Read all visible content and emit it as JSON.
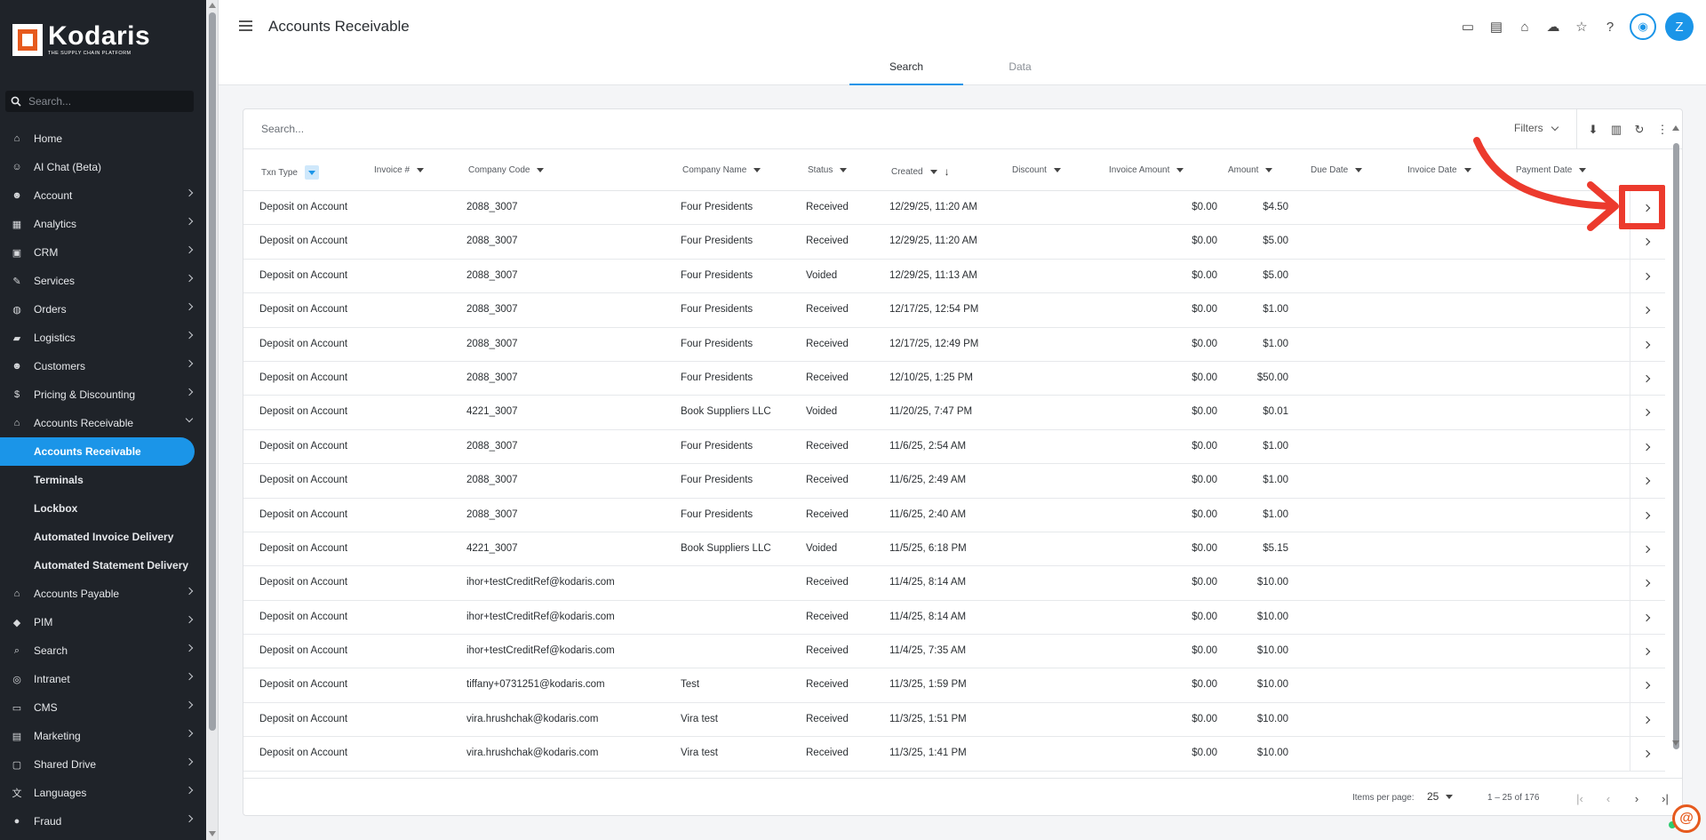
{
  "brand": {
    "name": "Kodaris",
    "tagline": "THE SUPPLY CHAIN PLATFORM",
    "accent": "#1b95e8",
    "logo_color": "#e65a1e"
  },
  "sidebar": {
    "search_placeholder": "Search...",
    "items": [
      {
        "label": "Home",
        "icon": "home-icon",
        "type": "top"
      },
      {
        "label": "AI Chat (Beta)",
        "icon": "robot-icon",
        "type": "top"
      },
      {
        "label": "Account",
        "icon": "person-icon",
        "type": "expand"
      },
      {
        "label": "Analytics",
        "icon": "chart-icon",
        "type": "expand"
      },
      {
        "label": "CRM",
        "icon": "contact-icon",
        "type": "expand"
      },
      {
        "label": "Services",
        "icon": "wrench-icon",
        "type": "expand"
      },
      {
        "label": "Orders",
        "icon": "car-icon",
        "type": "expand"
      },
      {
        "label": "Logistics",
        "icon": "truck-icon",
        "type": "expand"
      },
      {
        "label": "Customers",
        "icon": "people-icon",
        "type": "expand"
      },
      {
        "label": "Pricing & Discounting",
        "icon": "dollar-icon",
        "type": "expand"
      },
      {
        "label": "Accounts Receivable",
        "icon": "bank-icon",
        "type": "expanded"
      },
      {
        "label": "Accounts Receivable",
        "icon": "",
        "type": "active"
      },
      {
        "label": "Terminals",
        "icon": "",
        "type": "sub"
      },
      {
        "label": "Lockbox",
        "icon": "",
        "type": "sub"
      },
      {
        "label": "Automated Invoice Delivery",
        "icon": "",
        "type": "sub"
      },
      {
        "label": "Automated Statement Delivery",
        "icon": "",
        "type": "sub"
      },
      {
        "label": "Accounts Payable",
        "icon": "bank-icon",
        "type": "expand"
      },
      {
        "label": "PIM",
        "icon": "tag-icon",
        "type": "expand"
      },
      {
        "label": "Search",
        "icon": "search-icon",
        "type": "expand"
      },
      {
        "label": "Intranet",
        "icon": "globe-icon",
        "type": "expand"
      },
      {
        "label": "CMS",
        "icon": "layout-icon",
        "type": "expand"
      },
      {
        "label": "Marketing",
        "icon": "newspaper-icon",
        "type": "expand"
      },
      {
        "label": "Shared Drive",
        "icon": "folder-icon",
        "type": "expand"
      },
      {
        "label": "Languages",
        "icon": "translate-icon",
        "type": "expand"
      },
      {
        "label": "Fraud",
        "icon": "alert-icon",
        "type": "expand"
      }
    ]
  },
  "header": {
    "title": "Accounts Receivable",
    "avatar_initial": "Z"
  },
  "tabs": [
    {
      "label": "Search",
      "active": true
    },
    {
      "label": "Data",
      "active": false
    }
  ],
  "toolbar": {
    "search_placeholder": "Search...",
    "filters_label": "Filters"
  },
  "table": {
    "columns": [
      "Txn Type",
      "Invoice #",
      "Company Code",
      "Company Name",
      "Status",
      "Created",
      "Discount",
      "Invoice Amount",
      "Amount",
      "Due Date",
      "Invoice Date",
      "Payment Date"
    ],
    "rows": [
      [
        "Deposit on Account",
        "",
        "2088_3007",
        "Four Presidents",
        "Received",
        "12/29/25, 11:20 AM",
        "",
        "$0.00",
        "$4.50",
        "",
        "",
        ""
      ],
      [
        "Deposit on Account",
        "",
        "2088_3007",
        "Four Presidents",
        "Received",
        "12/29/25, 11:20 AM",
        "",
        "$0.00",
        "$5.00",
        "",
        "",
        ""
      ],
      [
        "Deposit on Account",
        "",
        "2088_3007",
        "Four Presidents",
        "Voided",
        "12/29/25, 11:13 AM",
        "",
        "$0.00",
        "$5.00",
        "",
        "",
        ""
      ],
      [
        "Deposit on Account",
        "",
        "2088_3007",
        "Four Presidents",
        "Received",
        "12/17/25, 12:54 PM",
        "",
        "$0.00",
        "$1.00",
        "",
        "",
        ""
      ],
      [
        "Deposit on Account",
        "",
        "2088_3007",
        "Four Presidents",
        "Received",
        "12/17/25, 12:49 PM",
        "",
        "$0.00",
        "$1.00",
        "",
        "",
        ""
      ],
      [
        "Deposit on Account",
        "",
        "2088_3007",
        "Four Presidents",
        "Received",
        "12/10/25, 1:25 PM",
        "",
        "$0.00",
        "$50.00",
        "",
        "",
        ""
      ],
      [
        "Deposit on Account",
        "",
        "4221_3007",
        "Book Suppliers LLC",
        "Voided",
        "11/20/25, 7:47 PM",
        "",
        "$0.00",
        "$0.01",
        "",
        "",
        ""
      ],
      [
        "Deposit on Account",
        "",
        "2088_3007",
        "Four Presidents",
        "Received",
        "11/6/25, 2:54 AM",
        "",
        "$0.00",
        "$1.00",
        "",
        "",
        ""
      ],
      [
        "Deposit on Account",
        "",
        "2088_3007",
        "Four Presidents",
        "Received",
        "11/6/25, 2:49 AM",
        "",
        "$0.00",
        "$1.00",
        "",
        "",
        ""
      ],
      [
        "Deposit on Account",
        "",
        "2088_3007",
        "Four Presidents",
        "Received",
        "11/6/25, 2:40 AM",
        "",
        "$0.00",
        "$1.00",
        "",
        "",
        ""
      ],
      [
        "Deposit on Account",
        "",
        "4221_3007",
        "Book Suppliers LLC",
        "Voided",
        "11/5/25, 6:18 PM",
        "",
        "$0.00",
        "$5.15",
        "",
        "",
        ""
      ],
      [
        "Deposit on Account",
        "",
        "ihor+testCreditRef@kodaris.com",
        "",
        "Received",
        "11/4/25, 8:14 AM",
        "",
        "$0.00",
        "$10.00",
        "",
        "",
        ""
      ],
      [
        "Deposit on Account",
        "",
        "ihor+testCreditRef@kodaris.com",
        "",
        "Received",
        "11/4/25, 8:14 AM",
        "",
        "$0.00",
        "$10.00",
        "",
        "",
        ""
      ],
      [
        "Deposit on Account",
        "",
        "ihor+testCreditRef@kodaris.com",
        "",
        "Received",
        "11/4/25, 7:35 AM",
        "",
        "$0.00",
        "$10.00",
        "",
        "",
        ""
      ],
      [
        "Deposit on Account",
        "",
        "tiffany+0731251@kodaris.com",
        "Test",
        "Received",
        "11/3/25, 1:59 PM",
        "",
        "$0.00",
        "$10.00",
        "",
        "",
        ""
      ],
      [
        "Deposit on Account",
        "",
        "vira.hrushchak@kodaris.com",
        "Vira test",
        "Received",
        "11/3/25, 1:51 PM",
        "",
        "$0.00",
        "$10.00",
        "",
        "",
        ""
      ],
      [
        "Deposit on Account",
        "",
        "vira.hrushchak@kodaris.com",
        "Vira test",
        "Received",
        "11/3/25, 1:41 PM",
        "",
        "$0.00",
        "$10.00",
        "",
        "",
        ""
      ]
    ]
  },
  "paginator": {
    "items_per_page_label": "Items per page:",
    "page_size": "25",
    "range": "1 – 25 of 176"
  },
  "annotation": {
    "color": "#ec3a2d"
  }
}
